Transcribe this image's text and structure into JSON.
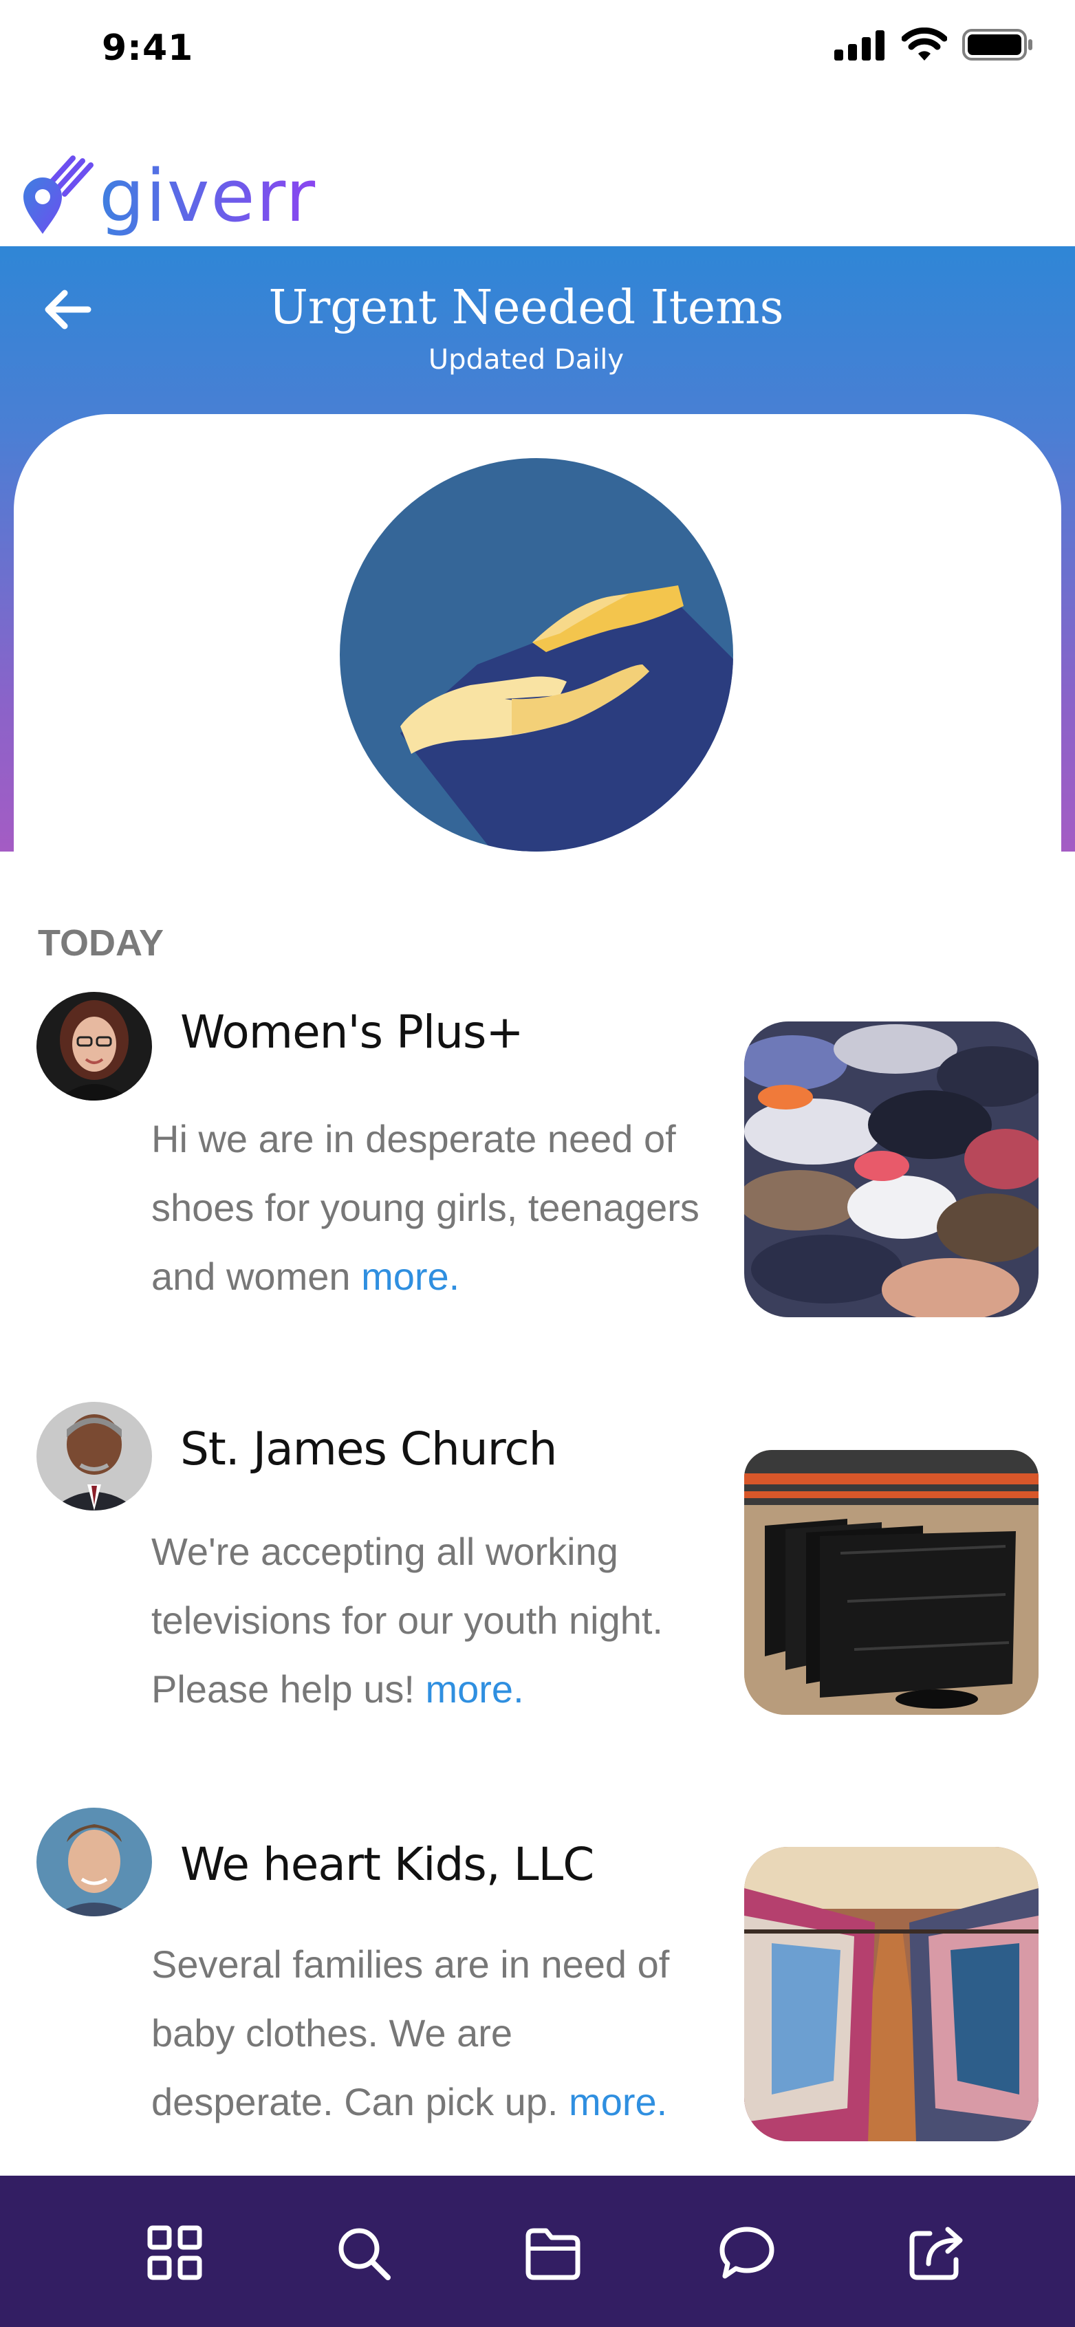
{
  "status": {
    "time": "9:41"
  },
  "brand": {
    "name": "giverr"
  },
  "header": {
    "title": "Urgent Needed Items",
    "subtitle": "Updated Daily"
  },
  "feed": {
    "section_label": "TODAY",
    "posts": [
      {
        "name": "Women's Plus+",
        "message": "Hi we are in desperate need of shoes for young girls, teenagers and women",
        "more_label": "more."
      },
      {
        "name": "St. James Church",
        "message": "We're accepting all working televisions for our youth night. Please help us!",
        "more_label": "more."
      },
      {
        "name": "We heart Kids, LLC",
        "message": "Several families are in need of baby clothes. We are desperate. Can pick up.",
        "more_label": "more."
      }
    ]
  },
  "bottom_nav": {
    "items": [
      {
        "icon": "grid-icon"
      },
      {
        "icon": "search-icon"
      },
      {
        "icon": "folder-icon"
      },
      {
        "icon": "chat-icon"
      },
      {
        "icon": "share-icon"
      }
    ]
  },
  "colors": {
    "header_gradient_top": "#2f86d6",
    "header_gradient_bottom": "#a45cc4",
    "link": "#2f8fe0",
    "nav_background": "#331e63"
  }
}
